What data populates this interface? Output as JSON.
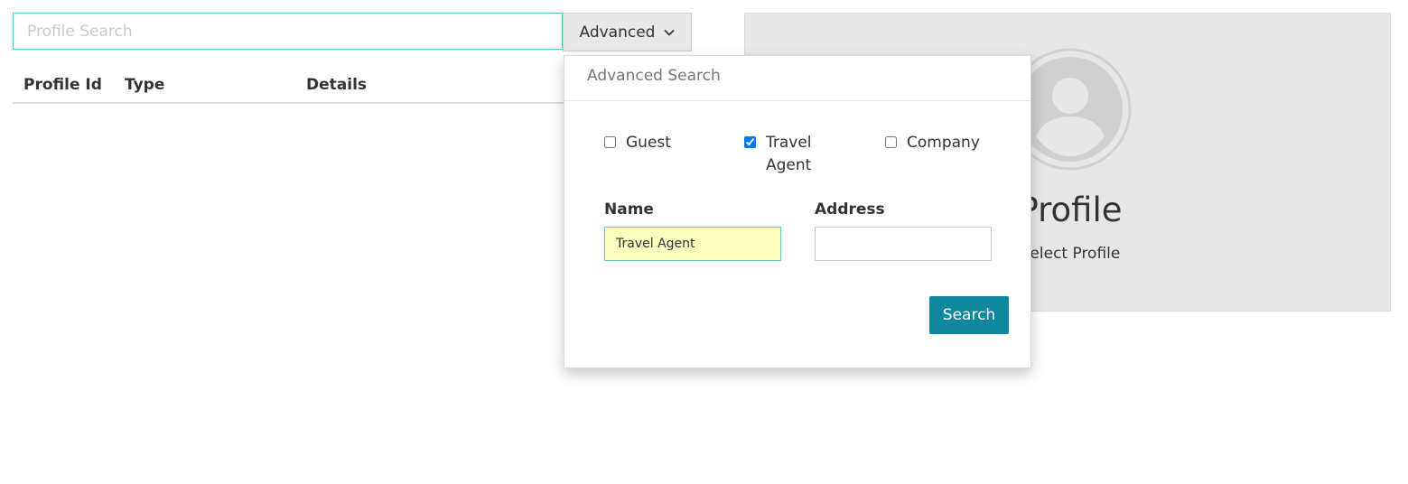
{
  "search": {
    "placeholder": "Profile Search",
    "value": "",
    "advanced_label": "Advanced"
  },
  "table": {
    "columns": [
      "Profile Id",
      "Type",
      "Details"
    ]
  },
  "profile_panel": {
    "title": "Profile",
    "subtitle": "Select Profile"
  },
  "advanced_search": {
    "header": "Advanced Search",
    "types": [
      {
        "label": "Guest",
        "checked": false
      },
      {
        "label": "Travel Agent",
        "checked": true
      },
      {
        "label": "Company",
        "checked": false
      }
    ],
    "name_label": "Name",
    "name_value": "Travel Agent",
    "address_label": "Address",
    "address_value": "",
    "search_label": "Search"
  },
  "colors": {
    "accent": "#0f879e",
    "focus_border": "#5fcf98",
    "autofill_bg": "#faffbd",
    "panel_bg": "#e7e7e7"
  },
  "icons": {
    "advanced_toggle": "chevron-down-icon",
    "profile_placeholder": "user-avatar-icon"
  }
}
